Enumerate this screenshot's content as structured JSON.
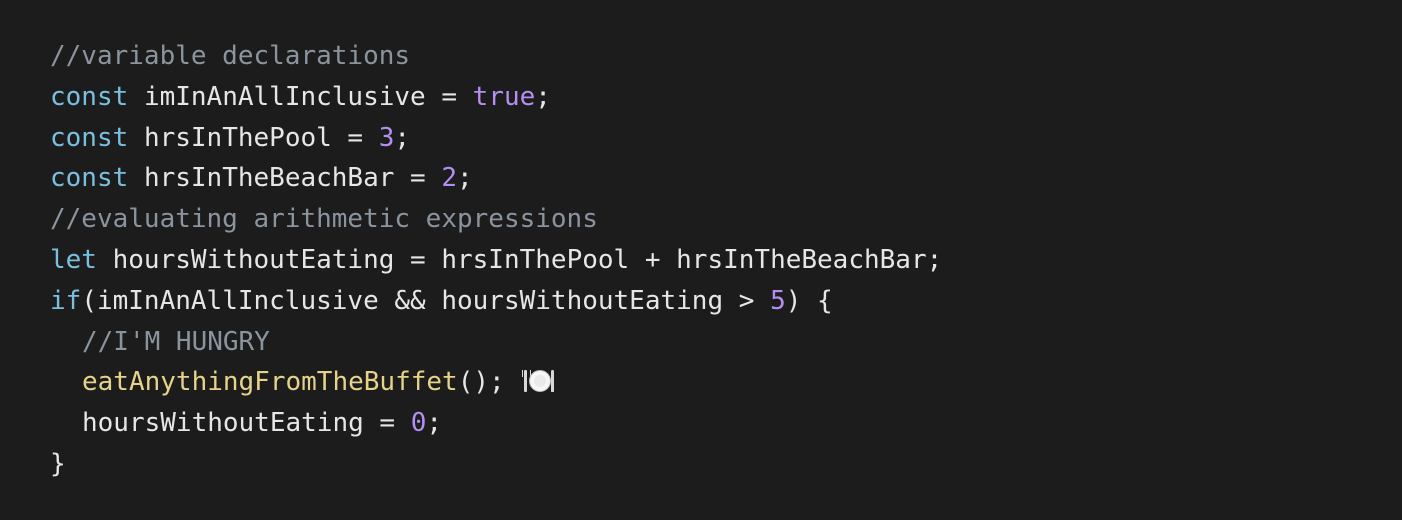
{
  "code": {
    "line1": {
      "comment": "//variable declarations"
    },
    "line2": {
      "kw": "const",
      "name": "imInAnAllInclusive",
      "op": " = ",
      "value": "true",
      "end": ";"
    },
    "line3": {
      "kw": "const",
      "name": "hrsInThePool",
      "op": " = ",
      "value": "3",
      "end": ";"
    },
    "line4": {
      "kw": "const",
      "name": "hrsInTheBeachBar",
      "op": " = ",
      "value": "2",
      "end": ";"
    },
    "line5": {
      "comment": "//evaluating arithmetic expressions"
    },
    "line6": {
      "kw": "let",
      "text": "hoursWithoutEating = hrsInThePool + hrsInTheBeachBar;"
    },
    "line7": {
      "kw": "if",
      "text_a": "(imInAnAllInclusive && hoursWithoutEating > ",
      "num": "5",
      "text_b": ") {"
    },
    "line8": {
      "comment": "//I'M HUNGRY"
    },
    "line9": {
      "func": "eatAnythingFromTheBuffet",
      "rest": "();",
      "icon": "fork-and-knife-with-plate-icon"
    },
    "line10": {
      "text": "hoursWithoutEating = ",
      "num": "0",
      "end": ";"
    },
    "line11": {
      "text": "}"
    }
  },
  "colors": {
    "background": "#1c1c1c",
    "comment": "#8b949e",
    "keyword": "#79c0e0",
    "literal": "#b48ef0",
    "function": "#e5d38a",
    "text": "#e6e6e6"
  }
}
